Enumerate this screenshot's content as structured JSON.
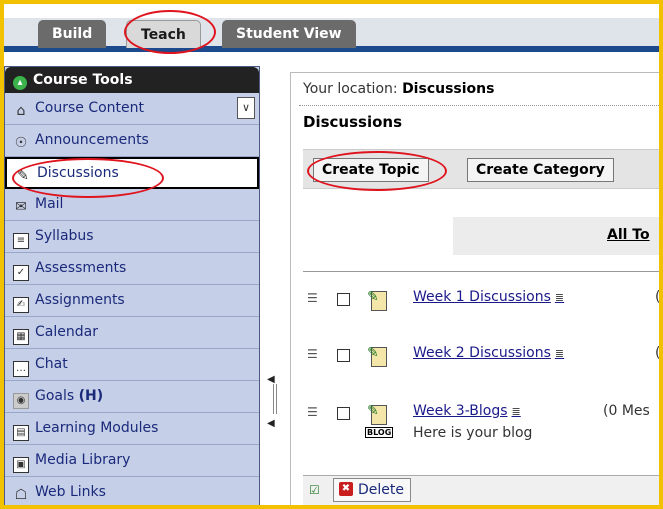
{
  "tabs": [
    {
      "label": "Build",
      "active": false
    },
    {
      "label": "Teach",
      "active": true
    },
    {
      "label": "Student View",
      "active": false
    }
  ],
  "sidebar": {
    "header": "Course Tools",
    "header_icon": "collapse-arrows-icon",
    "expand_icon": "double-chevron-icon",
    "items": [
      {
        "label": "Course Content",
        "icon": "course-content-icon"
      },
      {
        "label": "Announcements",
        "icon": "announcements-icon"
      },
      {
        "label": "Discussions",
        "icon": "discussions-icon",
        "active": true
      },
      {
        "label": "Mail",
        "icon": "mail-icon"
      },
      {
        "label": "Syllabus",
        "icon": "syllabus-icon"
      },
      {
        "label": "Assessments",
        "icon": "assessments-icon"
      },
      {
        "label": "Assignments",
        "icon": "assignments-icon"
      },
      {
        "label": "Calendar",
        "icon": "calendar-icon"
      },
      {
        "label": "Chat",
        "icon": "chat-icon"
      },
      {
        "label": "Goals",
        "suffix": "(H)",
        "icon": "goals-icon"
      },
      {
        "label": "Learning Modules",
        "icon": "learning-modules-icon"
      },
      {
        "label": "Media Library",
        "icon": "media-library-icon"
      },
      {
        "label": "Web Links",
        "icon": "web-links-icon"
      }
    ]
  },
  "content": {
    "location_label": "Your location:",
    "location_value": "Discussions",
    "title": "Discussions",
    "toolbar": {
      "create_topic": "Create Topic",
      "create_category": "Create Category"
    },
    "all_topics": "All To",
    "topics": [
      {
        "title": "Week 1 Discussions",
        "count": "(",
        "description": ""
      },
      {
        "title": "Week 2 Discussions",
        "count": "(",
        "description": ""
      },
      {
        "title": "Week 3-Blogs",
        "count": "(0 Mes",
        "description": "Here is your blog",
        "tag": "BLOG"
      }
    ],
    "delete_label": "Delete"
  },
  "colors": {
    "frame_border": "#f2c200",
    "tab_rule": "#1c4a8c",
    "sidebar_bg": "#c6cfe8",
    "highlight_oval": "#e0141e"
  }
}
